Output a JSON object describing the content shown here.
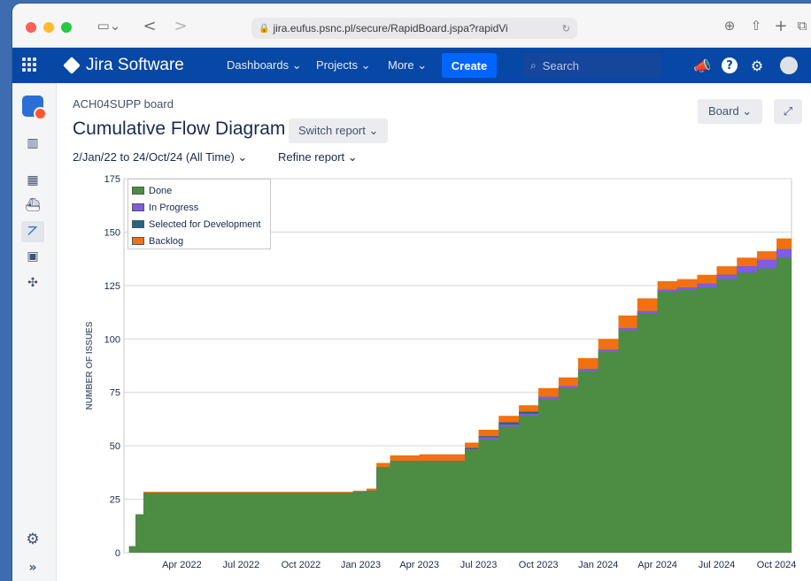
{
  "browser": {
    "url": "jira.eufus.psnc.pl/secure/RapidBoard.jspa?rapidVi",
    "nav_back": "<",
    "nav_forward": ">"
  },
  "nav": {
    "product": "Jira Software",
    "dashboards": "Dashboards ⌄",
    "projects": "Projects ⌄",
    "more": "More ⌄",
    "create": "Create",
    "search_placeholder": "Search"
  },
  "page": {
    "board_name": "ACH04SUPP board",
    "title": "Cumulative Flow Diagram",
    "switch_report": "Switch report ⌄",
    "board_button": "Board ⌄",
    "date_range": "2/Jan/22 to 24/Oct/24 (All Time) ⌄",
    "refine_report": "Refine report ⌄"
  },
  "chart_data": {
    "type": "area",
    "stacked": true,
    "ylabel": "NUMBER OF ISSUES",
    "ylim": [
      0,
      175
    ],
    "yticks": [
      "0",
      "25",
      "50",
      "75",
      "100",
      "125",
      "150",
      "175"
    ],
    "xlim": [
      "2022-01-02",
      "2024-10-24"
    ],
    "xticks": [
      {
        "date": "2022-04-01",
        "label": "Apr 2022"
      },
      {
        "date": "2022-07-01",
        "label": "Jul 2022"
      },
      {
        "date": "2022-10-01",
        "label": "Oct 2022"
      },
      {
        "date": "2023-01-01",
        "label": "Jan 2023"
      },
      {
        "date": "2023-04-01",
        "label": "Apr 2023"
      },
      {
        "date": "2023-07-01",
        "label": "Jul 2023"
      },
      {
        "date": "2023-10-01",
        "label": "Oct 2023"
      },
      {
        "date": "2024-01-01",
        "label": "Jan 2024"
      },
      {
        "date": "2024-04-01",
        "label": "Apr 2024"
      },
      {
        "date": "2024-07-01",
        "label": "Jul 2024"
      },
      {
        "date": "2024-10-01",
        "label": "Oct 2024"
      }
    ],
    "legend_position": "top-left",
    "x": [
      "2022-01-02",
      "2022-01-10",
      "2022-01-20",
      "2022-02-01",
      "2022-06-01",
      "2022-10-01",
      "2022-12-20",
      "2023-01-10",
      "2023-01-25",
      "2023-02-15",
      "2023-04-01",
      "2023-06-01",
      "2023-06-10",
      "2023-07-01",
      "2023-08-01",
      "2023-09-01",
      "2023-10-01",
      "2023-11-01",
      "2023-12-01",
      "2024-01-01",
      "2024-02-01",
      "2024-03-01",
      "2024-04-01",
      "2024-05-01",
      "2024-06-01",
      "2024-07-01",
      "2024-08-01",
      "2024-09-01",
      "2024-10-01",
      "2024-10-24"
    ],
    "series": [
      {
        "name": "Done",
        "color": "#4d8c43",
        "values": [
          0,
          3,
          18,
          28,
          28,
          28,
          28.5,
          29,
          40,
          43,
          43,
          43,
          48,
          53,
          59,
          64,
          72,
          77,
          85,
          94,
          104,
          112,
          122,
          123,
          124,
          128,
          131,
          133,
          138,
          146
        ]
      },
      {
        "name": "In Progress",
        "color": "#7d5ce6",
        "values": [
          0,
          0,
          0,
          0,
          0,
          0,
          0,
          0,
          0,
          0,
          0,
          0,
          0.5,
          1,
          1,
          1,
          1,
          1,
          1,
          1,
          1,
          1,
          1,
          1,
          2,
          2,
          3,
          4,
          4,
          5
        ]
      },
      {
        "name": "Selected for Development",
        "color": "#246783",
        "values": [
          0,
          0,
          0,
          0,
          0,
          0,
          0,
          0,
          0,
          0,
          0,
          0,
          0.5,
          0.5,
          1,
          1,
          0,
          0,
          0,
          0,
          0,
          0,
          0,
          0,
          0,
          0,
          0,
          0,
          0,
          0
        ]
      },
      {
        "name": "Backlog",
        "color": "#f2700f",
        "values": [
          0,
          0,
          0,
          0.5,
          0.5,
          0.5,
          0.5,
          1,
          2,
          2.5,
          3,
          3,
          2.5,
          3,
          3,
          3,
          4,
          4,
          5,
          5,
          6,
          6,
          4,
          4,
          4,
          4,
          4,
          4,
          5,
          12
        ]
      }
    ]
  }
}
